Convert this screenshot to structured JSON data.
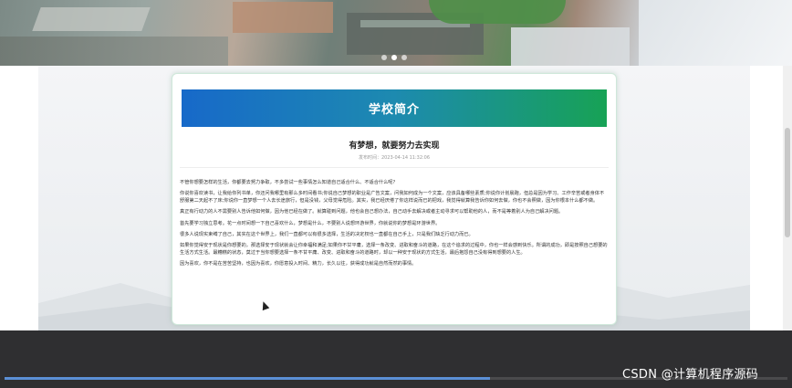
{
  "banner": {
    "carousel_count": 3,
    "active_index": 1
  },
  "card": {
    "title": "学校简介",
    "article_title": "有梦想，就要努力去实现",
    "meta": "发布时间：2023-04-14 11:32:06",
    "paragraphs": [
      "不管你想要怎样的生活，你都要去努力争取，不多尝试一些事情怎么知道自己适合什么、不适合什么呢？",
      "你说你喜欢读书，让我给你列书单，你还问我哪里有那么多时间看书;你说自己梦想的职业是广告文案，问我如何成为一个文案，应该具备哪些素质;你说你计划晨跑，但总是因为学习、工作辛苦或者身体不舒服第二天起不了床;你说你一直梦想一个人去长途旅行，但是没钱，父母觉得危险。其实，我已经厌倦了你这样说而已的把戏，我觉得就算我告诉你如何去做，你也不会照做，因为你根本什么都不做。",
      "真正有行动力的人不需要别人告诉他如何做，因为他已经在做了。就算碰到问题，他也会自己想办法，自己动手去解决或者主动寻求可以帮助他的人，而不是等着别人为自己解决问题。",
      "首先要学习独立思考。花一点时间想一下自己喜欢什么，梦想是什么，不要别人说想环游世界，你就说你的梦想是环游世界。",
      "很多人说现实束缚了自己，其实在这个世界上，我们一直都可以有很多选择，生活的决定权也一直都在自己手上，只是我们缺乏行动力而已。",
      "如果你觉得安于现状是你想要的，那选择安于现状就会让你幸福和满足;如果你不甘平庸，选择一条改变、进取和奋斗的道路，在这个追求的过程中，你也一样会感到快乐。所谓的成功，即是按照自己想要的生活方式生活。最糟糕的状态，莫过于当你想要选择一条不甘平庸、改变、进取和奋斗的道路时，却以一种安于现状的方式生活，最后抱怨自己没有得到想要的人生。",
      "因为喜欢，你不是在苦苦坚持，也因为喜欢，你愿意投入时间、精力，长久以往，获得成功就是自然而然的事情。"
    ]
  },
  "player": {
    "progress": 0.62
  },
  "watermark": "CSDN @计算机程序源码"
}
